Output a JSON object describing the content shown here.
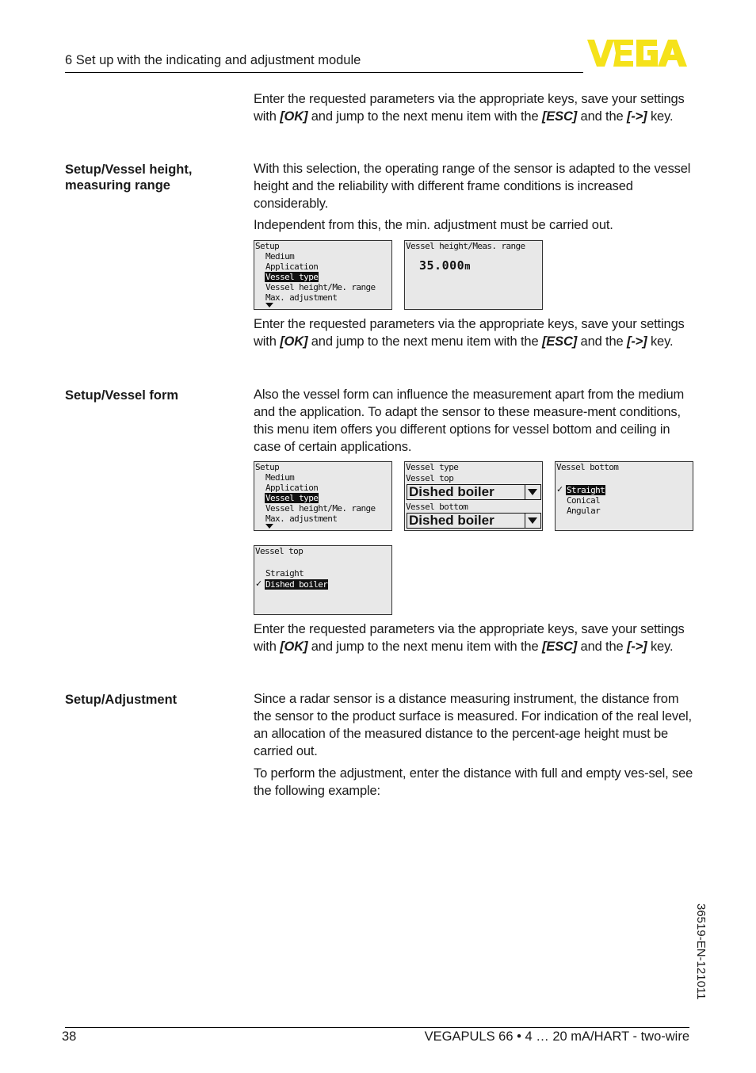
{
  "header": {
    "title": "6 Set up with the indicating and adjustment module",
    "logo_text": "VEGA",
    "logo_color": "#f5e21a"
  },
  "blocks": {
    "intro": {
      "pre": "Enter the requested parameters via the appropriate keys, save your settings with ",
      "k1": "[OK]",
      "mid": " and jump to the next menu item with the ",
      "k2": "[ESC]",
      "mid2": " and the ",
      "k3": "[->]",
      "post": " key."
    },
    "vessel_height": {
      "label": "Setup/Vessel height, measuring range",
      "p1": "With this selection, the operating range of the sensor is adapted to the vessel height and the reliability with different frame conditions is increased considerably.",
      "p2": "Independent from this, the min. adjustment must be carried out."
    },
    "vessel_form": {
      "label": "Setup/Vessel form",
      "p1": "Also the vessel form can influence the measurement apart from the medium and the application. To adapt the sensor to these measure-ment conditions, this menu item offers you different options for vessel bottom and ceiling in case of certain applications."
    },
    "adjustment": {
      "label": "Setup/Adjustment",
      "p1": "Since a radar sensor is a distance measuring instrument, the distance from the sensor to the product surface is measured. For indication of the real level, an allocation of the measured distance to the percent-age height must be carried out.",
      "p2": "To perform the adjustment, enter the distance with full and empty ves-sel, see the following example:"
    }
  },
  "lcd": {
    "setup_menu": {
      "title": "Setup",
      "items": [
        "Medium",
        "Application",
        "Vessel type",
        "Vessel height/Me. range",
        "Max. adjustment"
      ],
      "selected": "Vessel type"
    },
    "vessel_height": {
      "title": "Vessel height/Meas. range",
      "value": "35.000",
      "unit": "m"
    },
    "vessel_type": {
      "title": "Vessel type",
      "top_label": "Vessel top",
      "top_value": "Dished boiler",
      "bottom_label": "Vessel bottom",
      "bottom_value": "Dished boiler"
    },
    "vessel_bottom": {
      "title": "Vessel bottom",
      "options": [
        "Straight",
        "Conical",
        "Angular"
      ],
      "selected": "Straight"
    },
    "vessel_top": {
      "title": "Vessel top",
      "options": [
        "Straight",
        "Dished boiler"
      ],
      "selected": "Dished boiler"
    }
  },
  "footer": {
    "page": "38",
    "product": "VEGAPULS 66 • 4 … 20 mA/HART - two-wire",
    "doc_id": "36519-EN-121011"
  }
}
